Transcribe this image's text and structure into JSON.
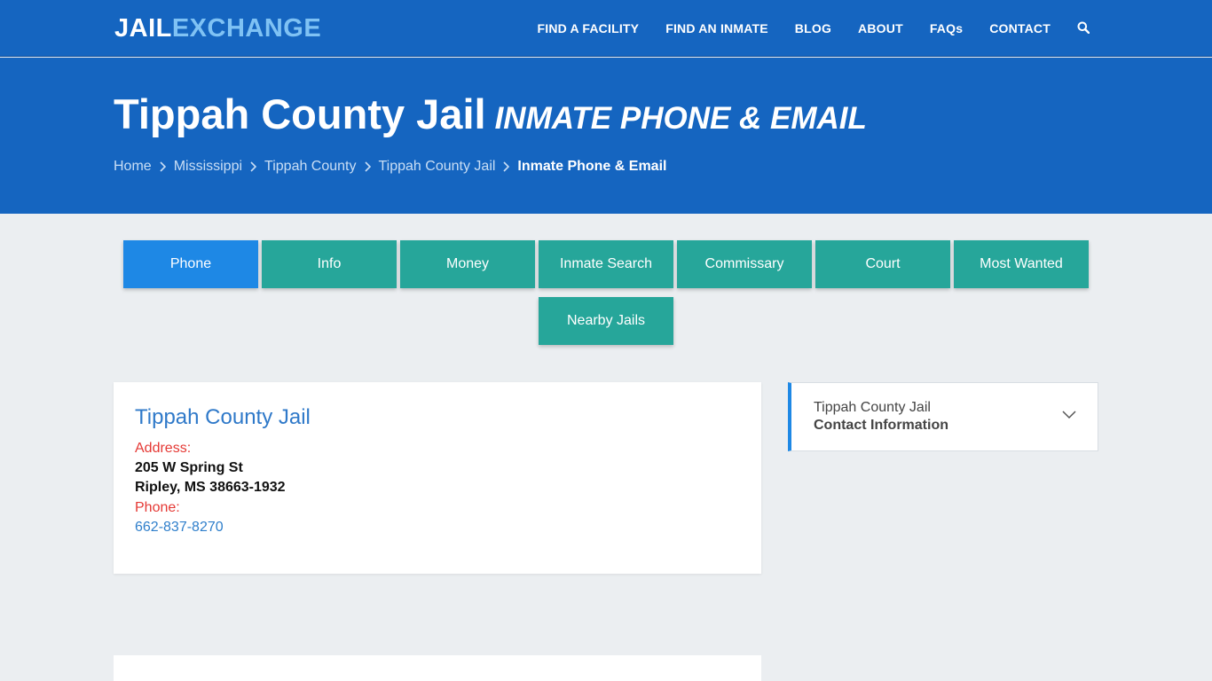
{
  "header": {
    "logo_part1": "JAIL",
    "logo_part2": "EXCHANGE",
    "nav": [
      "FIND A FACILITY",
      "FIND AN INMATE",
      "BLOG",
      "ABOUT",
      "FAQs",
      "CONTACT"
    ],
    "search_icon": "search-icon"
  },
  "hero": {
    "title": "Tippah County Jail",
    "subtitle": "Inmate Phone & Email",
    "breadcrumbs": [
      "Home",
      "Mississippi",
      "Tippah County",
      "Tippah County Jail"
    ],
    "breadcrumb_current": "Inmate Phone & Email"
  },
  "tabs": [
    "Phone",
    "Info",
    "Money",
    "Inmate Search",
    "Commissary",
    "Court",
    "Most Wanted",
    "Nearby Jails"
  ],
  "active_tab": "Phone",
  "facility": {
    "name": "Tippah County Jail",
    "address_label": "Address:",
    "address_line1": "205 W Spring St",
    "address_line2": "Ripley, MS 38663-1932",
    "phone_label": "Phone:",
    "phone": "662-837-8270"
  },
  "sidebar": {
    "title": "Tippah County Jail",
    "subtitle": "Contact Information",
    "icon": "chevron-down-icon"
  },
  "colors": {
    "header_blue": "#1565c0",
    "tab_teal": "#26a69a",
    "tab_active": "#1e88e5",
    "label_red": "#e53935"
  }
}
